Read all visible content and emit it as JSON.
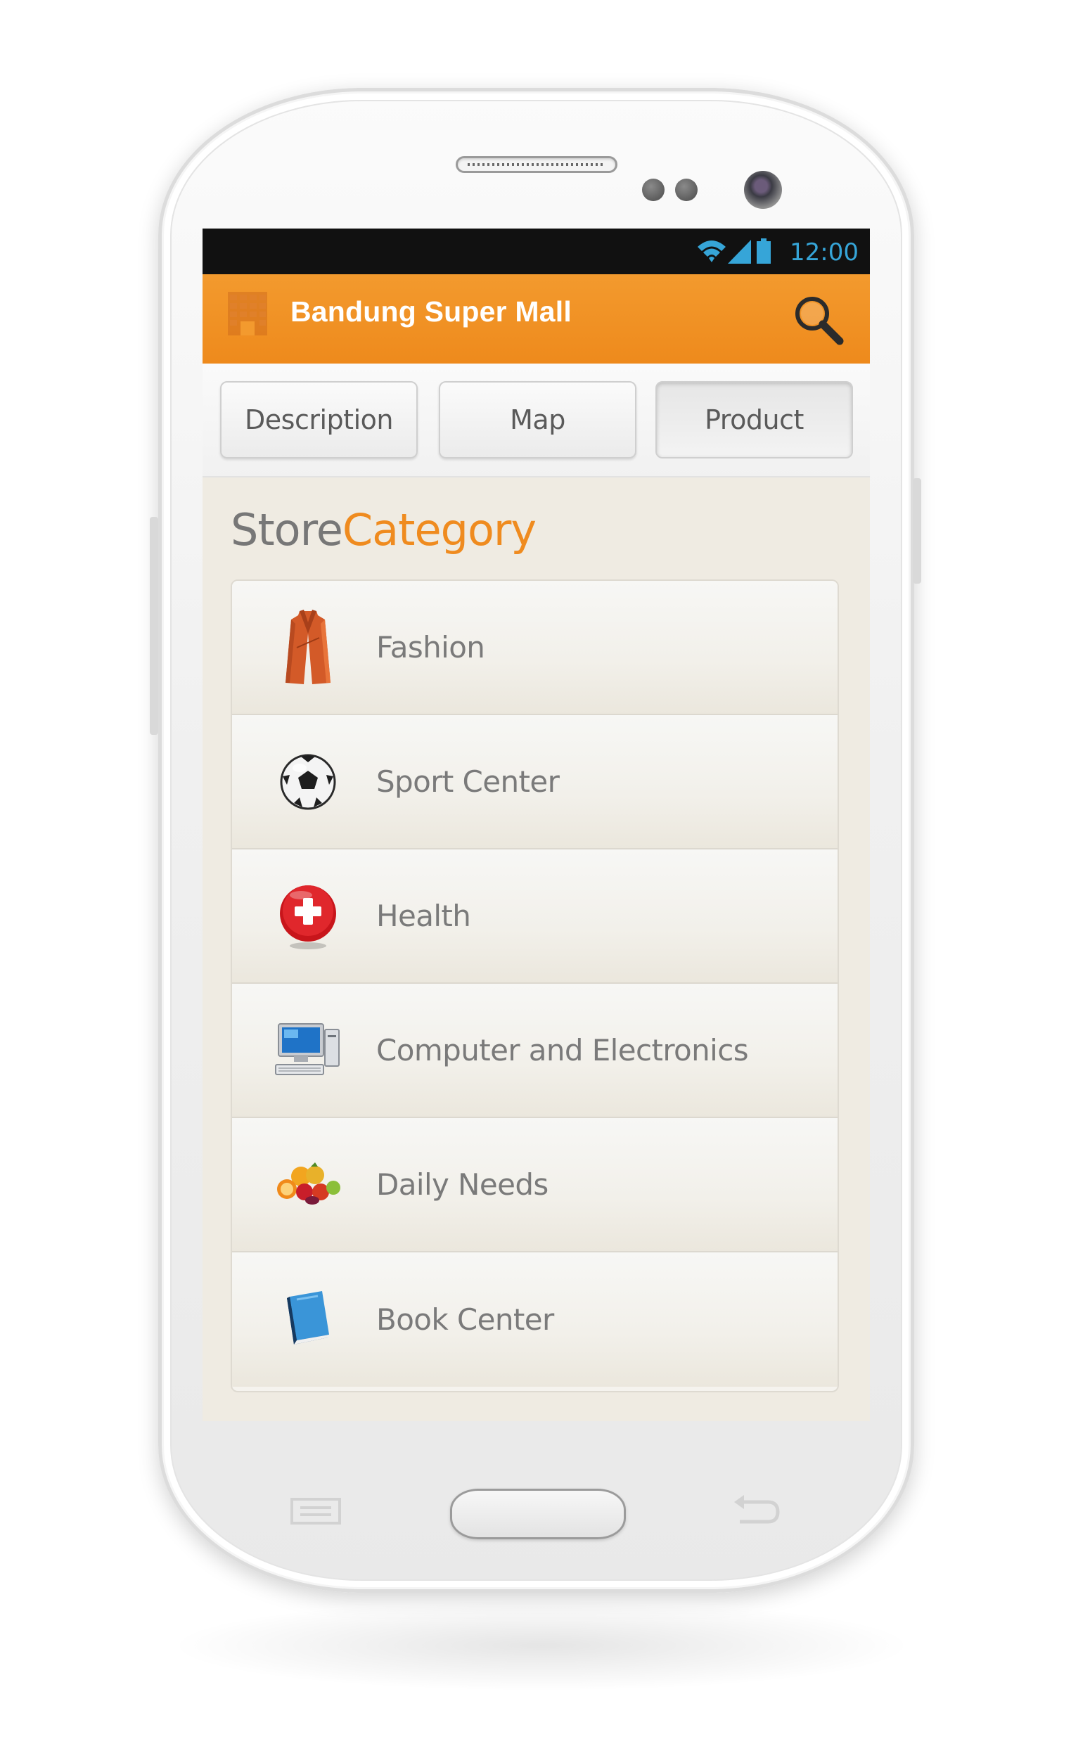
{
  "status_bar": {
    "time": "12:00",
    "icons": [
      "wifi-icon",
      "signal-icon",
      "battery-icon"
    ],
    "color": "#36a5d8"
  },
  "action_bar": {
    "title": "Bandung Super Mall",
    "background": "#ee8a1c",
    "app_icon": "mall-building-icon",
    "search_icon": "search-icon"
  },
  "tabs": [
    {
      "label": "Description",
      "active": false
    },
    {
      "label": "Map",
      "active": false
    },
    {
      "label": "Product",
      "active": true
    }
  ],
  "section_title": {
    "part1": "Store",
    "part2": "Category",
    "accent": "#ef8b1f"
  },
  "categories": [
    {
      "label": "Fashion",
      "icon": "coat-icon"
    },
    {
      "label": "Sport Center",
      "icon": "soccer-ball-icon"
    },
    {
      "label": "Health",
      "icon": "health-cross-icon"
    },
    {
      "label": "Computer and Electronics",
      "icon": "computer-icon"
    },
    {
      "label": "Daily Needs",
      "icon": "fruits-icon"
    },
    {
      "label": "Book Center",
      "icon": "book-icon"
    }
  ],
  "nav_keys": [
    "menu-key-icon",
    "home-key",
    "back-key-icon"
  ]
}
